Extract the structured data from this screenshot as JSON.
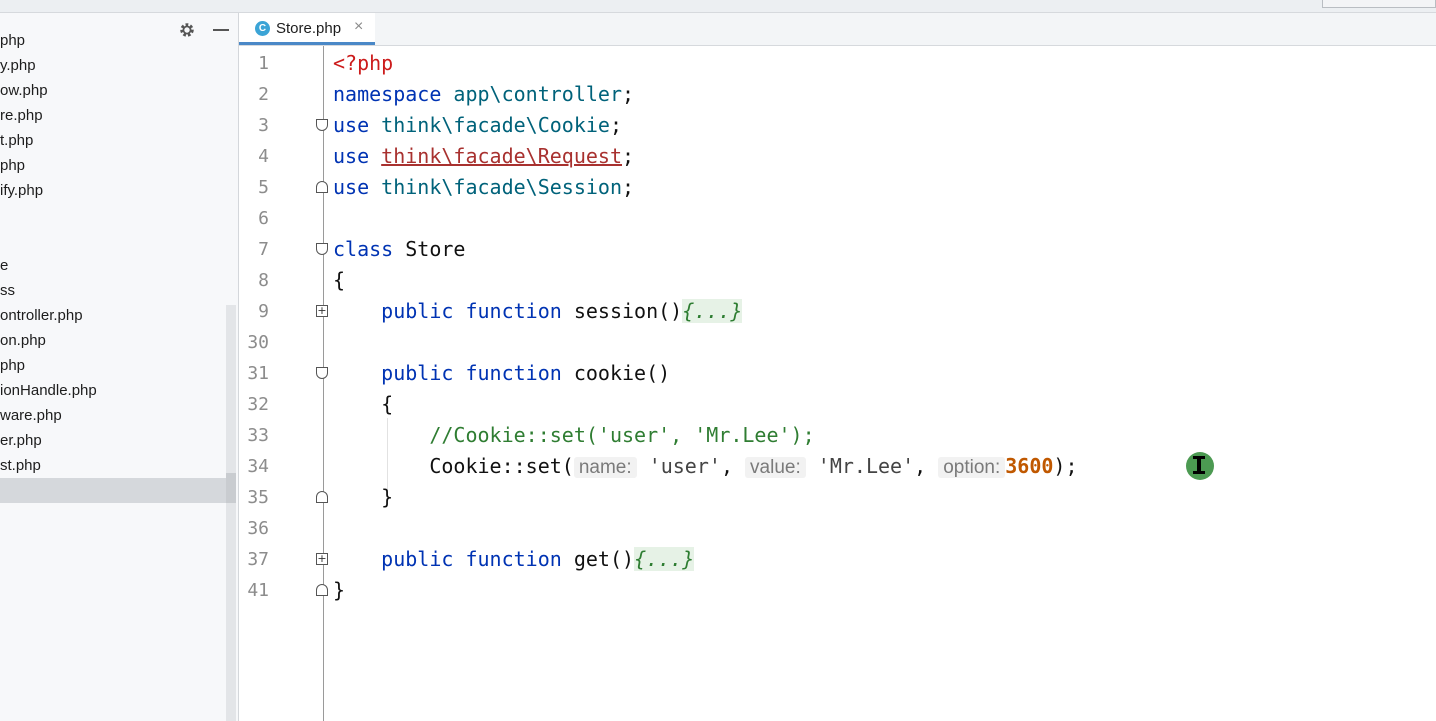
{
  "top_bar": {
    "breadcrumb_fragment": "php"
  },
  "project_tree": {
    "items": [
      {
        "label": "php"
      },
      {
        "label": "y.php"
      },
      {
        "label": "ow.php"
      },
      {
        "label": "re.php"
      },
      {
        "label": "t.php"
      },
      {
        "label": "php"
      },
      {
        "label": "ify.php"
      },
      {
        "label": ""
      },
      {
        "label": ""
      },
      {
        "label": "e"
      },
      {
        "label": "ss"
      },
      {
        "label": "ontroller.php"
      },
      {
        "label": "on.php"
      },
      {
        "label": "php"
      },
      {
        "label": "ionHandle.php"
      },
      {
        "label": "ware.php"
      },
      {
        "label": "er.php"
      },
      {
        "label": "st.php"
      },
      {
        "label": ""
      }
    ]
  },
  "tabs": [
    {
      "label": "Store.php",
      "icon": "php-class-icon",
      "icon_letter": "C",
      "close": "×"
    }
  ],
  "editor": {
    "line_numbers": [
      "1",
      "2",
      "3",
      "4",
      "5",
      "6",
      "7",
      "8",
      "9",
      "30",
      "31",
      "32",
      "33",
      "34",
      "35",
      "36",
      "37",
      "41"
    ],
    "code": {
      "l1_tag": "<?php",
      "l2_kw": "namespace",
      "l2_ns": "app\\controller",
      "l2_end": ";",
      "l3_kw": "use",
      "l3_ns": "think\\facade\\Cookie",
      "l3_end": ";",
      "l4_kw": "use",
      "l4_ns": "think\\facade\\Request",
      "l4_end": ";",
      "l5_kw": "use",
      "l5_ns": "think\\facade\\Session",
      "l5_end": ";",
      "l7_kw": "class",
      "l7_name": "Store",
      "l8": "{",
      "l9_kw1": "public",
      "l9_kw2": "function",
      "l9_name": "session()",
      "l9_fold": "{...}",
      "l31_kw1": "public",
      "l31_kw2": "function",
      "l31_name": "cookie()",
      "l32": "{",
      "l33_comment": "//Cookie::set('user', 'Mr.Lee');",
      "l34_call": "Cookie::set(",
      "l34_hint1": "name:",
      "l34_arg1": "'user'",
      "l34_sep1": ", ",
      "l34_hint2": "value:",
      "l34_arg2": "'Mr.Lee'",
      "l34_sep2": ", ",
      "l34_hint3": "option:",
      "l34_arg3": "3600",
      "l34_end": ");",
      "l35": "}",
      "l37_kw1": "public",
      "l37_kw2": "function",
      "l37_name": "get()",
      "l37_fold": "{...}",
      "l41": "}"
    }
  },
  "colors": {
    "keyword": "#0033b3",
    "namespace": "#00627a",
    "php_tag": "#cc1b1b",
    "error_underline": "#a8312f",
    "number": "#c05800",
    "comment": "#2f7d32",
    "tab_accent": "#4a88c7",
    "cursor_badge": "#4c9a52"
  }
}
